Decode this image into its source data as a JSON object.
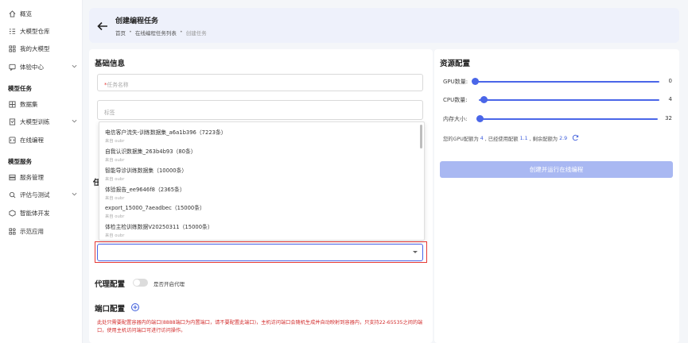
{
  "sidebar": {
    "items": [
      {
        "label": "概览",
        "icon": "home-icon"
      },
      {
        "label": "大模型仓库",
        "icon": "list-icon"
      },
      {
        "label": "我的大模型",
        "icon": "grid-icon"
      },
      {
        "label": "体验中心",
        "icon": "chat-icon"
      }
    ],
    "group_model_tasks": "模型任务",
    "task_items": [
      {
        "label": "数据集",
        "icon": "table-icon"
      },
      {
        "label": "大模型训练",
        "icon": "training-icon"
      },
      {
        "label": "在线编程",
        "icon": "code-icon"
      }
    ],
    "group_model_service": "模型服务",
    "service_items": [
      {
        "label": "服务管理",
        "icon": "server-icon"
      },
      {
        "label": "评估与测试",
        "icon": "evaluate-icon"
      },
      {
        "label": "智能体开发",
        "icon": "agent-icon"
      },
      {
        "label": "示范应用",
        "icon": "apps-icon"
      }
    ]
  },
  "header": {
    "title": "创建编程任务",
    "breadcrumb": [
      "首页",
      "在线编程任务列表",
      "创建任务"
    ]
  },
  "basic_info": {
    "title": "基础信息",
    "task_name_required": "*",
    "task_name_placeholder": "任务名称",
    "tags_placeholder": "标签",
    "section_hidden_letter": "任"
  },
  "dataset_options": [
    {
      "title": "电信客户流失-训练数据集_a6a1b396（7223条）",
      "source": "来自 oubr"
    },
    {
      "title": "自我认识数据集_263b4b93（80条）",
      "source": "来自 oubr"
    },
    {
      "title": "智能导诊训练数据集（10000条）",
      "source": "来自 oubr"
    },
    {
      "title": "体验报告_ee9646f8（2365条）",
      "source": "来自 oubr"
    },
    {
      "title": "export_15000_7aeadbec（15000条）",
      "source": "来自 oubr"
    },
    {
      "title": "体检主检训练数据V20250311（15000条）",
      "source": "来自 oubr"
    }
  ],
  "proxy": {
    "title": "代理配置",
    "toggle_label": "是否开启代理",
    "enabled": false
  },
  "port": {
    "title": "端口配置",
    "warning": "此处只需要配置容器内的端口(8888端口为内置端口，请不要配置此端口)，主机访问端口会随机生成并自动映射到容器内，只支持22-65535之间的端口，使用主机访问端口可进行访问操作。"
  },
  "resources": {
    "title": "资源配置",
    "gpu_label": "GPU数量:",
    "gpu_value": "0",
    "gpu_fraction": 0,
    "cpu_label": "CPU数量:",
    "cpu_value": "4",
    "cpu_fraction": 0.03,
    "mem_label": "内存大小:",
    "mem_value": "32",
    "mem_fraction": 0.02,
    "quota_prefix": "您的GPU配额为",
    "quota_total": "4",
    "quota_mid": ", 已经使用配额",
    "quota_used": "1.1",
    "quota_rest_label": ", 剩余配额为",
    "quota_rest": "2.9",
    "submit_label": "创建并运行在线编程"
  },
  "colors": {
    "accent": "#4a66e8",
    "highlight": "#e53935",
    "warning": "#d32f2f"
  }
}
